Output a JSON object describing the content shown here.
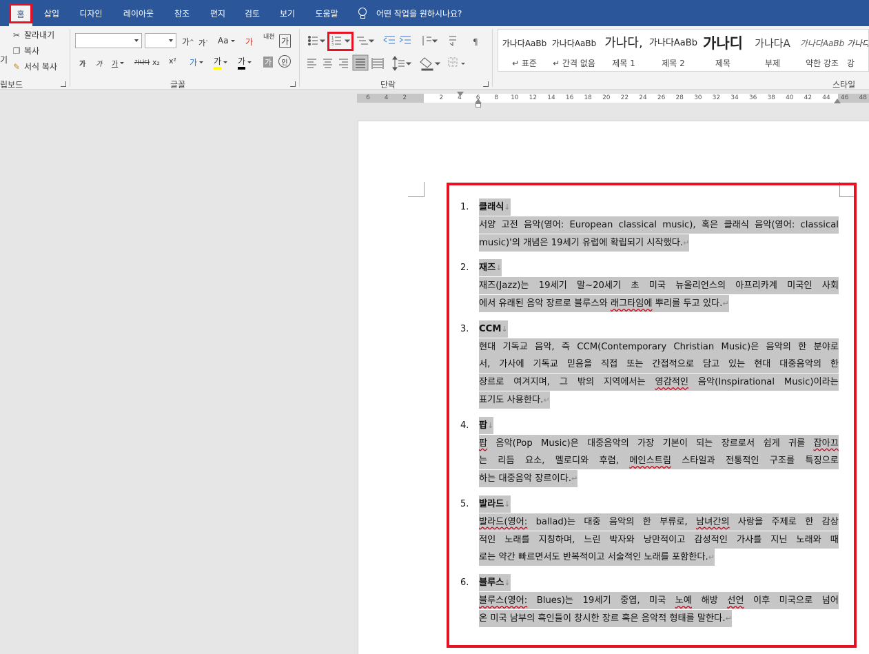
{
  "tabs": [
    {
      "label": "홈",
      "active": true
    },
    {
      "label": "삽입"
    },
    {
      "label": "디자인"
    },
    {
      "label": "레이아웃"
    },
    {
      "label": "참조"
    },
    {
      "label": "편지"
    },
    {
      "label": "검토"
    },
    {
      "label": "보기"
    },
    {
      "label": "도움말"
    }
  ],
  "tell_me": "어떤 작업을 원하시나요?",
  "clipboard": {
    "cut": "잘라내기",
    "copy": "복사",
    "format_painter": "서식 복사",
    "label": "립보드",
    "paste_fragment": "기"
  },
  "font": {
    "label": "글꼴",
    "grow": "가",
    "shrink": "가",
    "case": "Aa",
    "clear": "가",
    "phonetic": "내천",
    "charborder": "가",
    "bold": "가",
    "italic": "가",
    "underline": "가",
    "strike": "가나다",
    "sub": "x₂",
    "sup": "x²",
    "effects": "가",
    "highlight": "가",
    "fontcolor": "가",
    "shade": "가",
    "enclose": "인"
  },
  "paragraph": {
    "label": "단락"
  },
  "styles": {
    "label": "스타일",
    "items": [
      {
        "sample": "가나다AaBb",
        "name": "↵ 표준"
      },
      {
        "sample": "가나다AaBb",
        "name": "↵ 간격 없음"
      },
      {
        "sample": "가나다,",
        "name": "제목 1"
      },
      {
        "sample": "가나다AaBb",
        "name": "제목 2"
      },
      {
        "sample": "가나디",
        "name": "제목"
      },
      {
        "sample": "가나다A",
        "name": "부제"
      },
      {
        "sample": "가나다AaBb",
        "name": "약한 강조"
      },
      {
        "sample": "가나다",
        "name": "강"
      }
    ]
  },
  "ruler_ticks": [
    "6",
    "4",
    "2",
    "",
    "2",
    "4",
    "6",
    "8",
    "10",
    "12",
    "14",
    "16",
    "18",
    "20",
    "22",
    "24",
    "26",
    "28",
    "30",
    "32",
    "34",
    "36",
    "38",
    "40",
    "42",
    "44",
    "46",
    "48"
  ],
  "document": {
    "items": [
      {
        "number": "1.",
        "title": "클래식",
        "lines": [
          [
            "서양",
            "고전",
            "음악(영어:",
            "European",
            "classical",
            "music),",
            "혹은",
            "클래식",
            "음악(영어:",
            "classical"
          ],
          [
            "music)'의",
            "개념은",
            "19세기",
            "유럽에",
            "확립되기",
            "시작했다."
          ]
        ]
      },
      {
        "number": "2.",
        "title": "재즈",
        "lines": [
          [
            "재즈(Jazz)는",
            "19세기",
            "말~20세기",
            "초",
            "미국",
            "뉴올리언스의",
            "아프리카계",
            "미국인",
            "사회"
          ],
          [
            "에서",
            "유래된",
            "음악",
            "장르로",
            "블루스와",
            "래그타임에",
            "뿌리를",
            "두고",
            "있다."
          ]
        ]
      },
      {
        "number": "3.",
        "title": "CCM",
        "lines": [
          [
            "현대",
            "기독교",
            "음악,",
            "즉",
            "CCM(Contemporary",
            "Christian",
            "Music)은",
            "음악의",
            "한",
            "분야로"
          ],
          [
            "서,",
            "가사에",
            "기독교",
            "믿음을",
            "직접",
            "또는",
            "간접적으로",
            "담고",
            "있는",
            "현대",
            "대중음악의",
            "한"
          ],
          [
            "장르로",
            "여겨지며,",
            "그",
            "밖의",
            "지역에서는",
            "영감적인",
            "음악(Inspirational",
            "Music)이라는"
          ],
          [
            "표기도",
            "사용한다."
          ]
        ]
      },
      {
        "number": "4.",
        "title": "팝",
        "lines": [
          [
            "팝",
            "음악(Pop",
            "Music)은",
            "대중음악의",
            "가장",
            "기본이",
            "되는",
            "장르로서",
            "쉽게",
            "귀를",
            "잡아끄"
          ],
          [
            "는",
            "리듬",
            "요소,",
            "멜로디와",
            "후렴,",
            "메인스트림",
            "스타일과",
            "전통적인",
            "구조를",
            "특징으로"
          ],
          [
            "하는",
            "대중음악",
            "장르이다."
          ]
        ]
      },
      {
        "number": "5.",
        "title": "발라드",
        "lines": [
          [
            "발라드(영어:",
            "ballad)는",
            "대중",
            "음악의",
            "한",
            "부류로,",
            "남녀간의",
            "사랑을",
            "주제로",
            "한",
            "감상"
          ],
          [
            "적인",
            "노래를",
            "지칭하며,",
            "느린",
            "박자와",
            "낭만적이고",
            "감성적인",
            "가사를",
            "지닌",
            "노래와",
            "때"
          ],
          [
            "로는",
            "약간",
            "빠르면서도",
            "반복적이고",
            "서술적인",
            "노래를",
            "포함한다."
          ]
        ]
      },
      {
        "number": "6.",
        "title": "블루스",
        "lines": [
          [
            "블루스(영어:",
            "Blues)는",
            "19세기",
            "중엽,",
            "미국",
            "노예",
            "해방",
            "선언",
            "이후",
            "미국으로",
            "넘어"
          ],
          [
            "온",
            "미국",
            "남부의",
            "흑인들이",
            "창시한",
            "장르",
            "혹은",
            "음악적",
            "형태를",
            "말한다."
          ]
        ]
      }
    ]
  }
}
